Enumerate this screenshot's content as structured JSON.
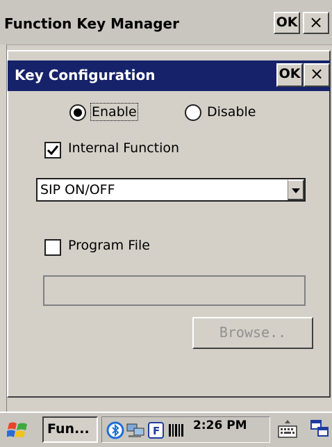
{
  "outer_window": {
    "title": "Function Key Manager",
    "ok_label": "OK",
    "close_label": "×"
  },
  "dialog": {
    "title": "Key Configuration",
    "ok_label": "OK",
    "close_label": "×",
    "enable_label": "Enable",
    "disable_label": "Disable",
    "mode_selected": "Enable",
    "internal_function_label": "Internal Function",
    "internal_function_checked": true,
    "function_select_value": "SIP ON/OFF",
    "program_file_label": "Program File",
    "program_file_checked": false,
    "program_path_value": "",
    "browse_label": "Browse.."
  },
  "taskbar": {
    "task_label": "Fun...",
    "clock": "2:26 PM",
    "icons": [
      "start-icon",
      "bluetooth-icon",
      "network-icon",
      "f-key-icon",
      "barcode-icon",
      "keyboard-icon",
      "desktop-icon"
    ]
  }
}
